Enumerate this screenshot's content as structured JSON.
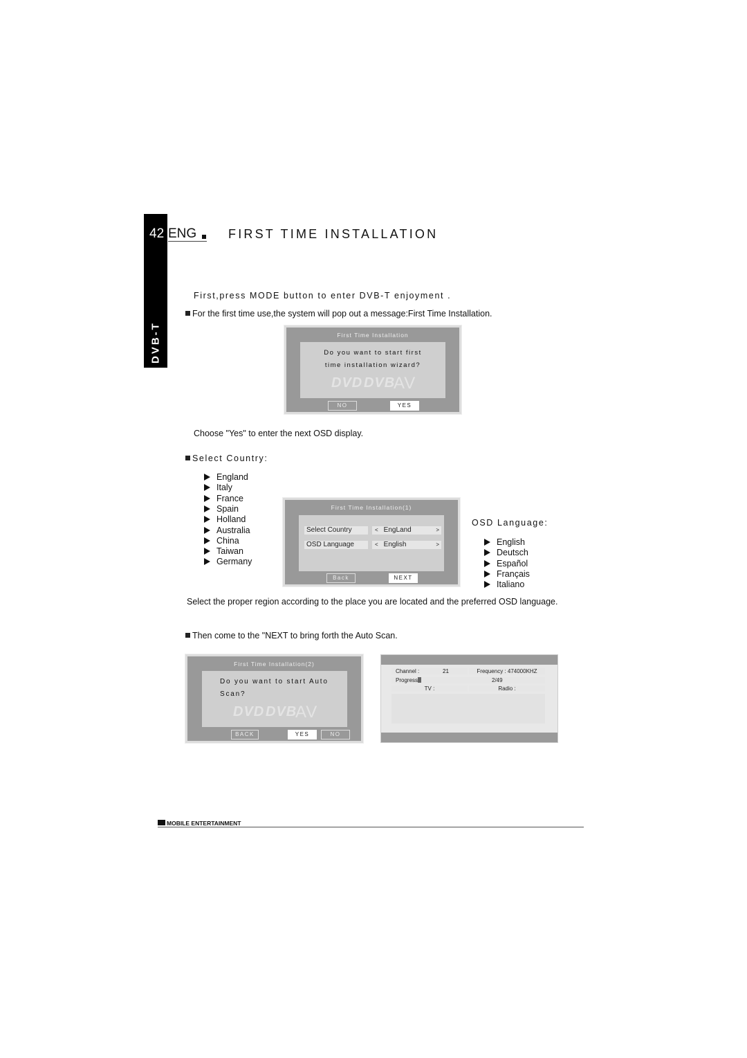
{
  "page": {
    "number": "42",
    "lang": "ENG",
    "section": "DVB-T",
    "title": "FIRST TIME INSTALLATION",
    "footer": "MOBILE ENTERTAINMENT"
  },
  "intro": {
    "line1": "First,press MODE button to enter DVB-T enjoyment .",
    "line2": "For the first time use,the system will pop out a message:First Time Installation."
  },
  "dialog1": {
    "title": "First Time Installation",
    "message_line1": "Do you want to start first",
    "message_line2": "time installation wizard?",
    "no": "NO",
    "yes": "YES",
    "logos": [
      "DVD",
      "DVB",
      "AV"
    ]
  },
  "choose_text": "Choose \"Yes\" to enter the next OSD display.",
  "select_country": {
    "heading": "Select Country:",
    "items": [
      "England",
      "Italy",
      "France",
      "Spain",
      "Holland",
      "Australia",
      "China",
      "Taiwan",
      "Germany"
    ]
  },
  "dialog2": {
    "title": "First Time Installation(1)",
    "country_label": "Select Country",
    "country_value": "EngLand",
    "language_label": "OSD Language",
    "language_value": "English",
    "prev": "<",
    "next_arrow": ">",
    "back": "Back",
    "next": "NEXT"
  },
  "osd_language": {
    "heading": "OSD Language:",
    "items": [
      "English",
      "Deutsch",
      "Español",
      "Français",
      "Italiano"
    ]
  },
  "region_text": "Select the proper region according to the place you are located and the preferred OSD language.",
  "then_text": "Then come to the \"NEXT  to bring forth the Auto Scan.",
  "dialog3": {
    "title": "First Time Installation(2)",
    "message_line1": "Do you want to start Auto",
    "message_line2": "Scan?",
    "back": "BACK",
    "yes": "YES",
    "no": "NO"
  },
  "scan": {
    "channel_label": "Channel :",
    "channel_value": "21",
    "frequency": "Frequency : 474000KHZ",
    "progress_label": "Progress",
    "progress_value": "2/49",
    "progress_fraction": 0.04,
    "tv": "TV :",
    "radio": "Radio :"
  }
}
